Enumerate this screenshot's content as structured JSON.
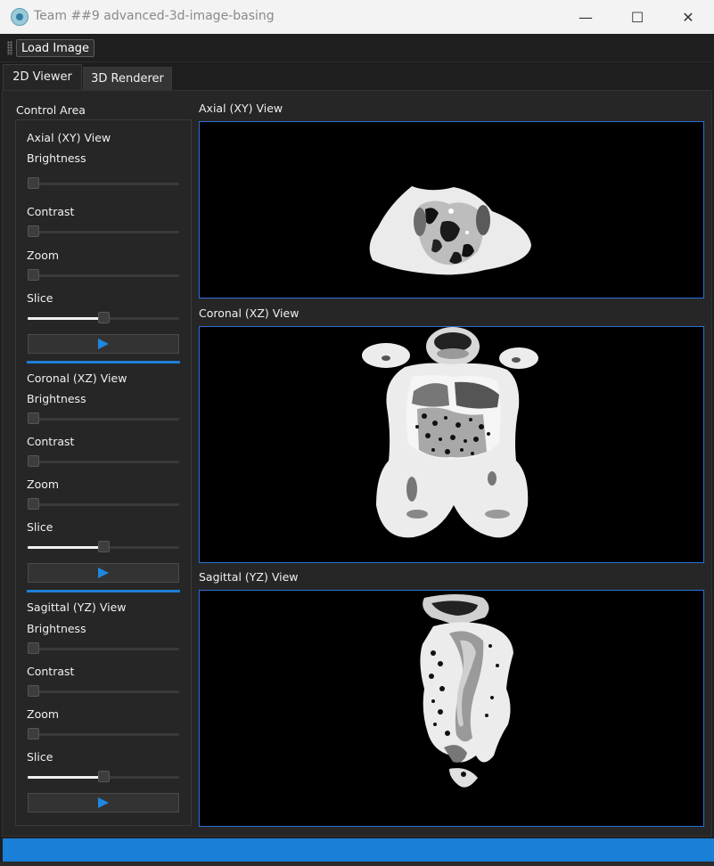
{
  "window": {
    "title": "Team ##9 advanced-3d-image-basing",
    "minimize_glyph": "—",
    "maximize_glyph": "☐",
    "close_glyph": "✕"
  },
  "toolbar": {
    "load_image_label": "Load Image"
  },
  "tabs": [
    {
      "label": "2D Viewer",
      "active": true
    },
    {
      "label": "3D Renderer",
      "active": false
    }
  ],
  "control_area": {
    "title": "Control Area",
    "sections": [
      {
        "title": "Axial (XY) View",
        "brightness_label": "Brightness",
        "brightness_value": 0,
        "contrast_label": "Contrast",
        "contrast_value": 0,
        "zoom_label": "Zoom",
        "zoom_value": 0,
        "slice_label": "Slice",
        "slice_value": 0.5
      },
      {
        "title": "Coronal (XZ) View",
        "brightness_label": "Brightness",
        "brightness_value": 0,
        "contrast_label": "Contrast",
        "contrast_value": 0,
        "zoom_label": "Zoom",
        "zoom_value": 0,
        "slice_label": "Slice",
        "slice_value": 0.5
      },
      {
        "title": "Sagittal (YZ) View",
        "brightness_label": "Brightness",
        "brightness_value": 0,
        "contrast_label": "Contrast",
        "contrast_value": 0,
        "zoom_label": "Zoom",
        "zoom_value": 0,
        "slice_label": "Slice",
        "slice_value": 0.5
      }
    ]
  },
  "views": {
    "axial_title": "Axial (XY) View",
    "coronal_title": "Coronal (XZ) View",
    "sagittal_title": "Sagittal (YZ) View"
  },
  "colors": {
    "accent": "#1d7fd6",
    "view_border": "#2e6fd6",
    "play_icon": "#1e87e0"
  },
  "icons": {
    "app": "app-logo-icon",
    "play": "play-icon",
    "grip": "toolbar-grip-icon"
  }
}
